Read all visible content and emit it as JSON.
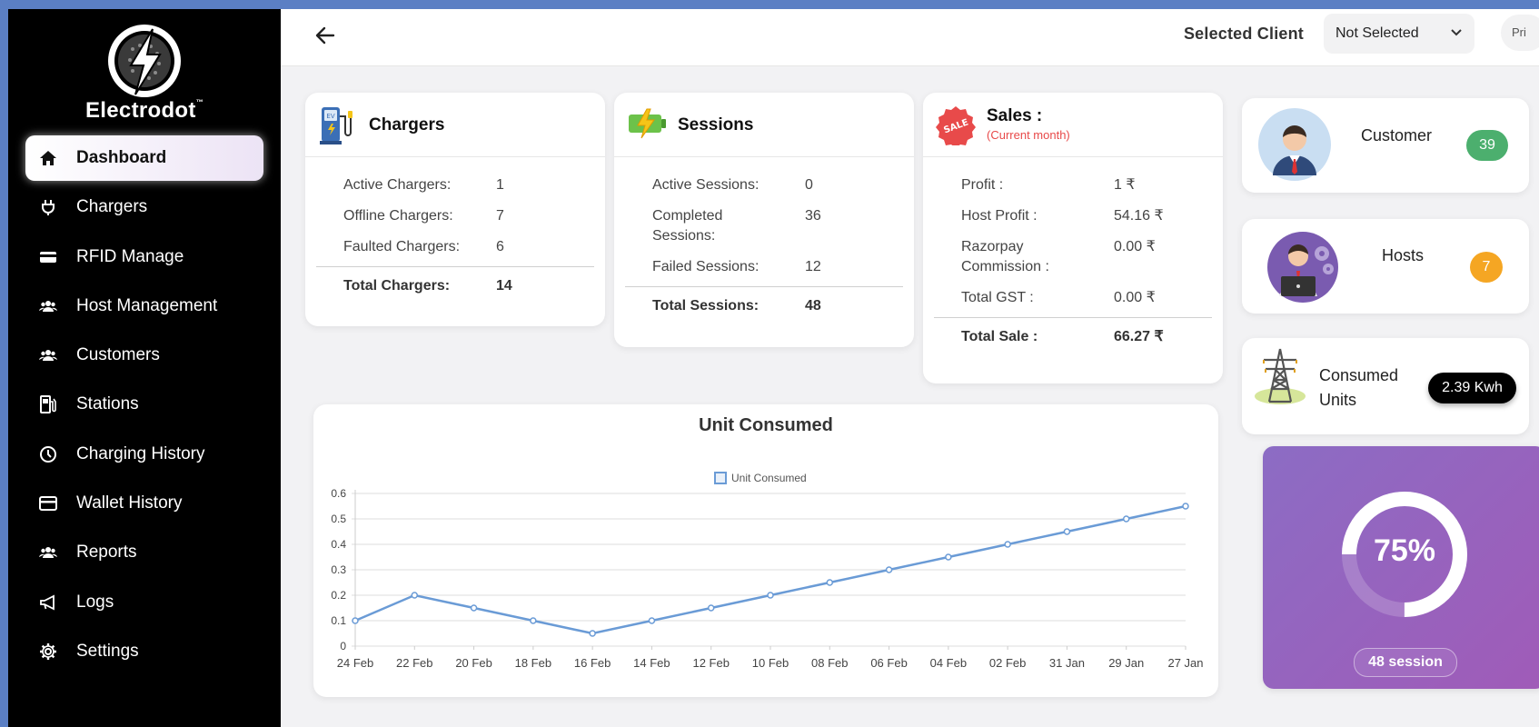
{
  "brand": {
    "name": "Electrodot",
    "tm": "™"
  },
  "sidebar": {
    "items": [
      {
        "label": "Dashboard",
        "icon": "home-icon"
      },
      {
        "label": "Chargers",
        "icon": "plug-icon"
      },
      {
        "label": "RFID Manage",
        "icon": "card-icon"
      },
      {
        "label": "Host Management",
        "icon": "users-icon"
      },
      {
        "label": "Customers",
        "icon": "users-icon"
      },
      {
        "label": "Stations",
        "icon": "fuel-station-icon"
      },
      {
        "label": "Charging History",
        "icon": "clock-icon"
      },
      {
        "label": "Wallet History",
        "icon": "wallet-icon"
      },
      {
        "label": "Reports",
        "icon": "users-icon"
      },
      {
        "label": "Logs",
        "icon": "megaphone-icon"
      },
      {
        "label": "Settings",
        "icon": "gear-icon"
      }
    ]
  },
  "topbar": {
    "client_label": "Selected Client",
    "client_value": "Not Selected",
    "profile_text": "Pri"
  },
  "chargers": {
    "title": "Chargers",
    "rows": [
      {
        "label": "Active Chargers:",
        "value": "1"
      },
      {
        "label": "Offline Chargers:",
        "value": "7"
      },
      {
        "label": "Faulted Chargers:",
        "value": "6"
      }
    ],
    "total": {
      "label": "Total Chargers:",
      "value": "14"
    }
  },
  "sessions": {
    "title": "Sessions",
    "rows": [
      {
        "label": "Active Sessions:",
        "value": "0"
      },
      {
        "label": "Completed Sessions:",
        "value": "36"
      },
      {
        "label": "Failed Sessions:",
        "value": "12"
      }
    ],
    "total": {
      "label": "Total Sessions:",
      "value": "48"
    }
  },
  "sales": {
    "title": "Sales :",
    "subtitle": "(Current month)",
    "badge": "SALE",
    "rows": [
      {
        "label": "Profit :",
        "value": "1 ₹"
      },
      {
        "label": "Host Profit :",
        "value": "54.16 ₹"
      },
      {
        "label": "Razorpay Commission :",
        "value": "0.00 ₹"
      },
      {
        "label": "Total GST :",
        "value": "0.00 ₹"
      }
    ],
    "total": {
      "label": "Total Sale :",
      "value": "66.27 ₹"
    }
  },
  "customer_card": {
    "label": "Customer",
    "count": "39"
  },
  "hosts_card": {
    "label": "Hosts",
    "count": "7"
  },
  "units_card": {
    "label": "Consumed Units",
    "value": "2.39 Kwh"
  },
  "progress_card": {
    "percent_label": "75%",
    "progress": 0.75,
    "sessions_label": "48 session"
  },
  "colors": {
    "accent_line": "#6a9bd6",
    "customer_badge": "#4caf6e",
    "hosts_badge": "#f5a623"
  },
  "chart_data": {
    "type": "line",
    "title": "Unit Consumed",
    "legend": [
      "Unit Consumed"
    ],
    "legend_position": "top",
    "categories": [
      "24 Feb",
      "22 Feb",
      "20 Feb",
      "18 Feb",
      "16 Feb",
      "14 Feb",
      "12 Feb",
      "10 Feb",
      "08 Feb",
      "06 Feb",
      "04 Feb",
      "02 Feb",
      "31 Jan",
      "29 Jan",
      "27 Jan"
    ],
    "series": [
      {
        "name": "Unit Consumed",
        "values": [
          0.1,
          0.2,
          0.15,
          0.1,
          0.05,
          0.1,
          0.15,
          0.2,
          0.25,
          0.3,
          0.35,
          0.4,
          0.45,
          0.5,
          0.55
        ]
      }
    ],
    "ylim": [
      0,
      0.6
    ],
    "yticks": [
      "0",
      "0.1",
      "0.2",
      "0.3",
      "0.4",
      "0.5",
      "0.6"
    ],
    "grid": true
  }
}
